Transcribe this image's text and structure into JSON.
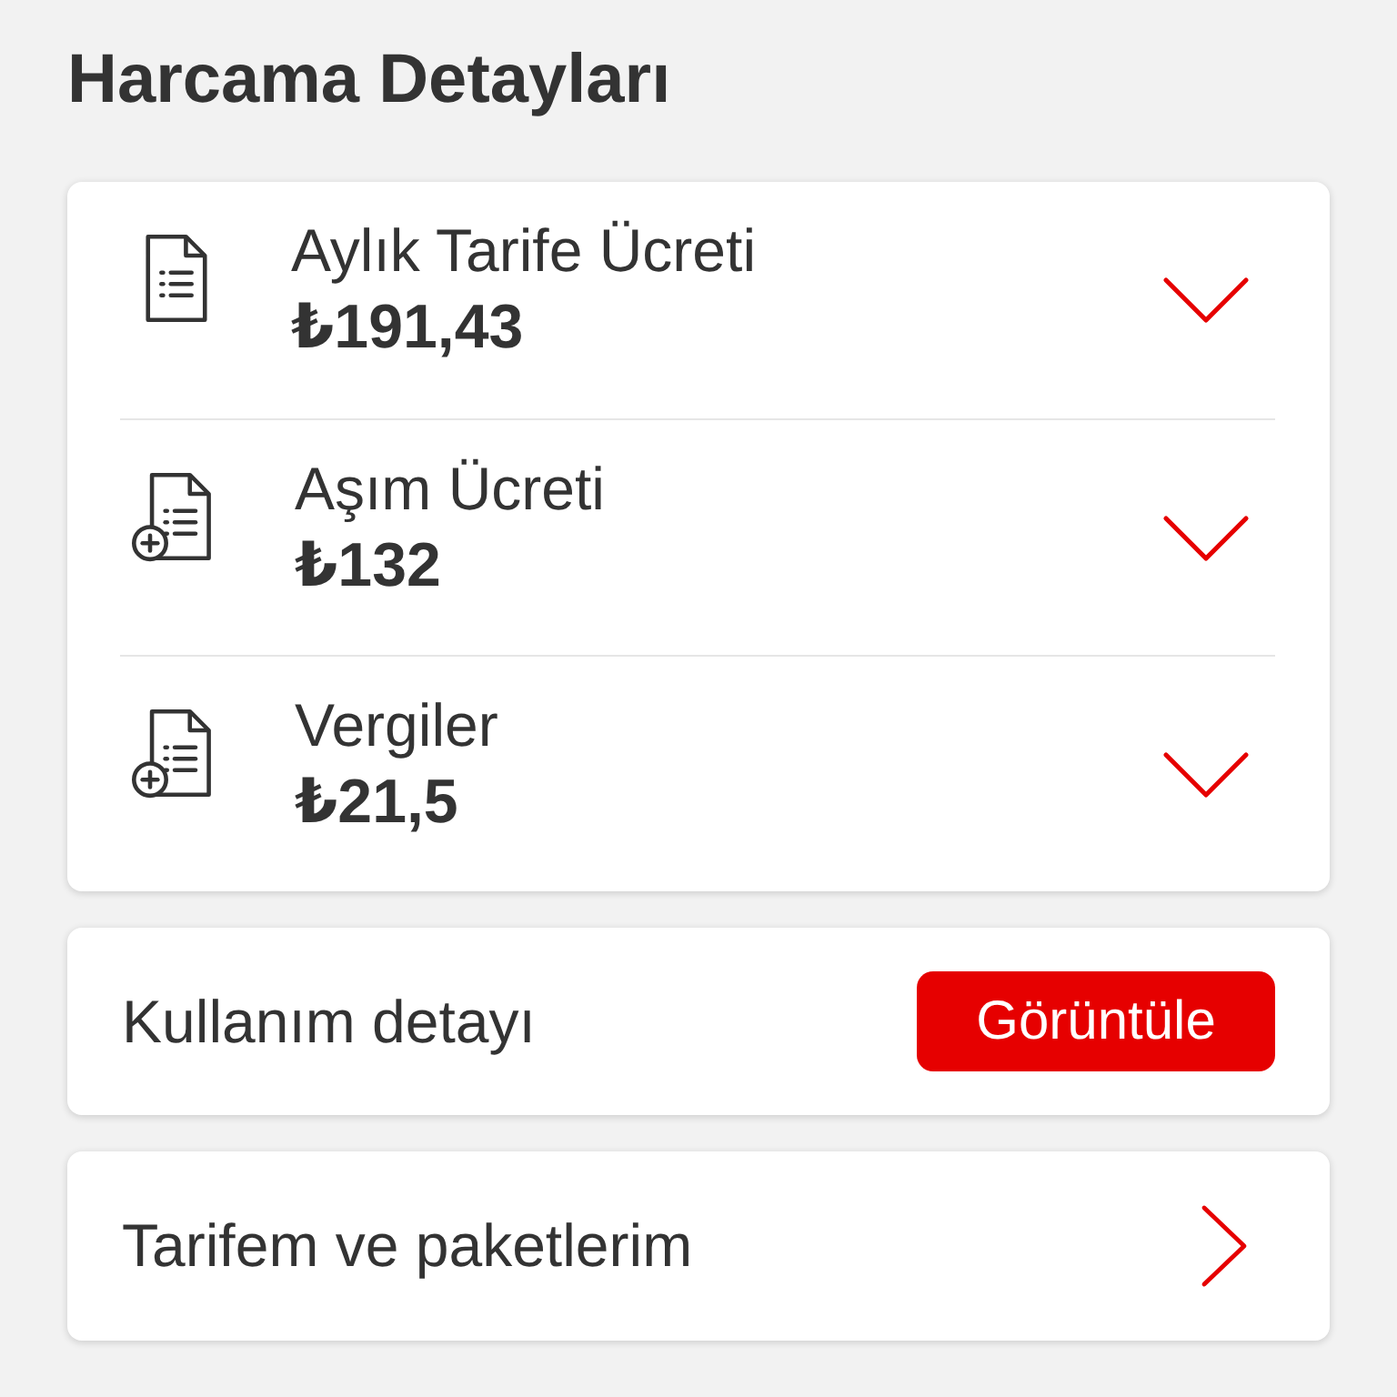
{
  "title": "Harcama Detayları",
  "charges": [
    {
      "kind": "plain",
      "label": "Aylık Tarife Ücreti",
      "amount": "₺191,43",
      "expanded": false
    },
    {
      "kind": "addon",
      "label": "Aşım Ücreti",
      "amount": "₺132",
      "expanded": false
    },
    {
      "kind": "addon",
      "label": "Vergiler",
      "amount": "₺21,5",
      "expanded": false
    }
  ],
  "usage": {
    "label": "Kullanım detayı",
    "button": "Görüntüle"
  },
  "tariff": {
    "label": "Tarifem ve paketlerim"
  }
}
